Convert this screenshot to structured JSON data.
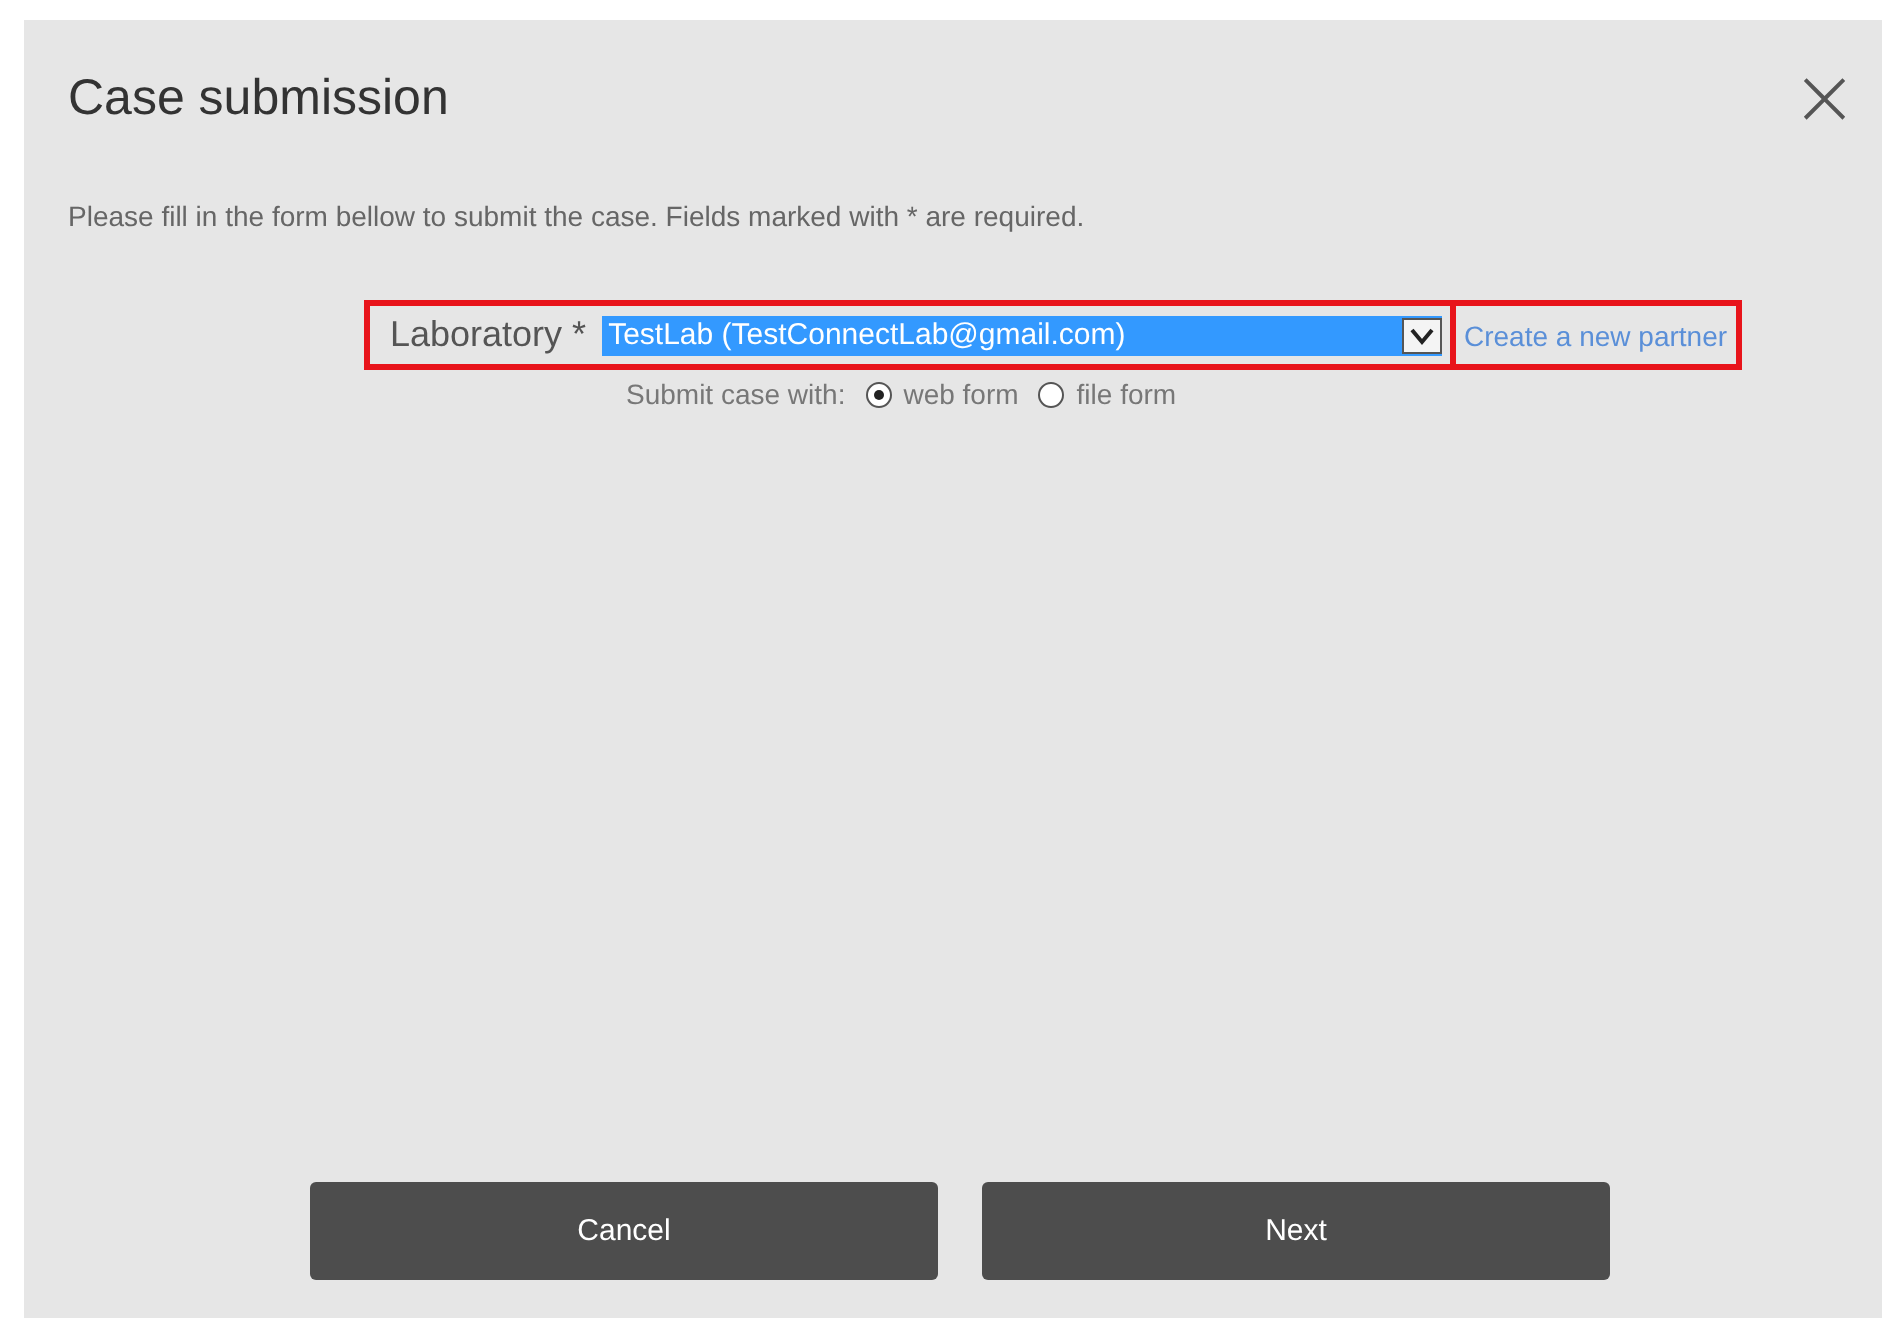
{
  "dialog": {
    "title": "Case submission",
    "close": "×",
    "instruction": "Please fill in the form bellow to submit the case. Fields marked with * are required."
  },
  "laboratory": {
    "label": "Laboratory *",
    "value": "TestLab (TestConnectLab@gmail.com)",
    "highlighted": true
  },
  "create_partner_link": {
    "label": "Create a new partner",
    "highlighted": true
  },
  "submit_with": {
    "label": "Submit case with:",
    "options": [
      {
        "label": "web form",
        "selected": true
      },
      {
        "label": "file form",
        "selected": false
      }
    ]
  },
  "buttons": [
    {
      "label": "Cancel"
    },
    {
      "label": "Next"
    }
  ]
}
